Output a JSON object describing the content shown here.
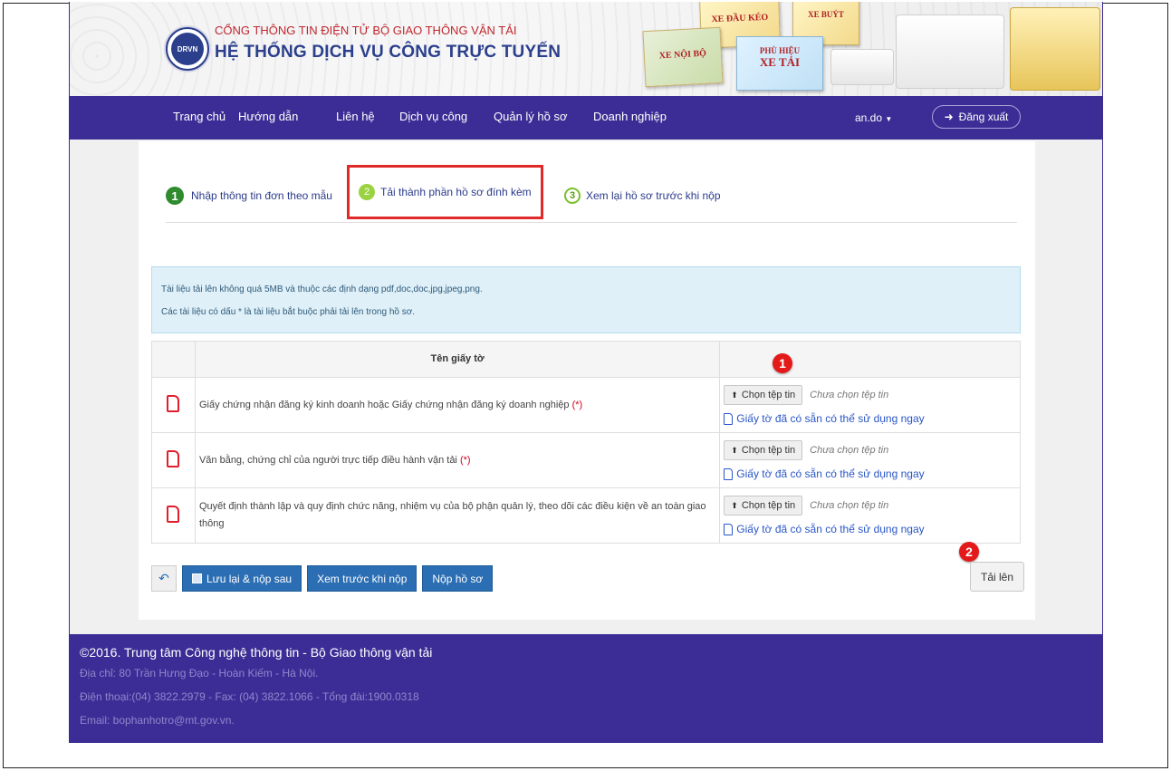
{
  "header": {
    "org_line1": "CỔNG THÔNG TIN ĐIỆN TỬ BỘ GIAO THÔNG VẬN TẢI",
    "org_line2": "HỆ THỐNG DỊCH VỤ CÔNG TRỰC TUYẾN",
    "logo_text": "DRVN",
    "cards": [
      "XE ĐẦU KÉO",
      "XE BUÝT",
      "XE NỘI BỘ",
      "PHÙ HIỆU",
      "XE TẢI"
    ]
  },
  "nav": {
    "items": [
      "Trang chủ",
      "Hướng dẫn",
      "Liên hệ",
      "Dịch vụ công",
      "Quản lý hồ sơ",
      "Doanh nghiệp"
    ],
    "user": "an.do",
    "logout": "Đăng xuất"
  },
  "steps": [
    {
      "num": "1",
      "label": "Nhập thông tin đơn theo mẫu"
    },
    {
      "num": "2",
      "label": "Tải thành phần hồ sơ đính kèm"
    },
    {
      "num": "3",
      "label": "Xem lại hồ sơ trước khi nộp"
    }
  ],
  "info": {
    "line1": "Tài liệu tải lên không quá 5MB và thuộc các định dạng pdf,doc,doc,jpg,jpeg,png.",
    "line2": "Các tài liệu có dấu * là tài liệu bắt buộc phải tải lên trong hồ sơ."
  },
  "table": {
    "header": "Tên giấy tờ",
    "choose_label": "Chọn tệp tin",
    "no_file_label": "Chưa chọn tệp tin",
    "existing_label": "Giấy tờ đã có sẵn có thể sử dụng ngay",
    "required_mark": "(*)",
    "rows": [
      {
        "name": "Giấy chứng nhận đăng ký kinh doanh hoặc Giấy chứng nhận đăng ký doanh nghiệp",
        "required": true
      },
      {
        "name": "Văn bằng, chứng chỉ của người trực tiếp điều hành vận tải",
        "required": true
      },
      {
        "name": "Quyết định thành lập và quy định chức năng, nhiệm vụ của bộ phận quản lý, theo dõi các điều kiện về an toàn giao thông",
        "required": false
      }
    ]
  },
  "badges": [
    "1",
    "2"
  ],
  "buttons": {
    "save_later": "Lưu lại & nộp sau",
    "preview": "Xem trước khi nộp",
    "submit": "Nộp hồ sơ",
    "upload": "Tải lên"
  },
  "footer": {
    "copyright": "©2016. Trung tâm Công nghệ thông tin - Bộ Giao thông vận tải",
    "address": "Địa chỉ: 80 Trần Hưng Đạo - Hoàn Kiếm - Hà Nội.",
    "phone": "Điện thoại:(04) 3822.2979 - Fax: (04) 3822.1066 - Tổng đài:1900.0318",
    "email": "Email: bophanhotro@mt.gov.vn."
  },
  "colors": {
    "brand_purple": "#3b2d95",
    "accent_red": "#e02a2a",
    "link_blue": "#2a56c6",
    "button_blue": "#2b6eb4"
  }
}
